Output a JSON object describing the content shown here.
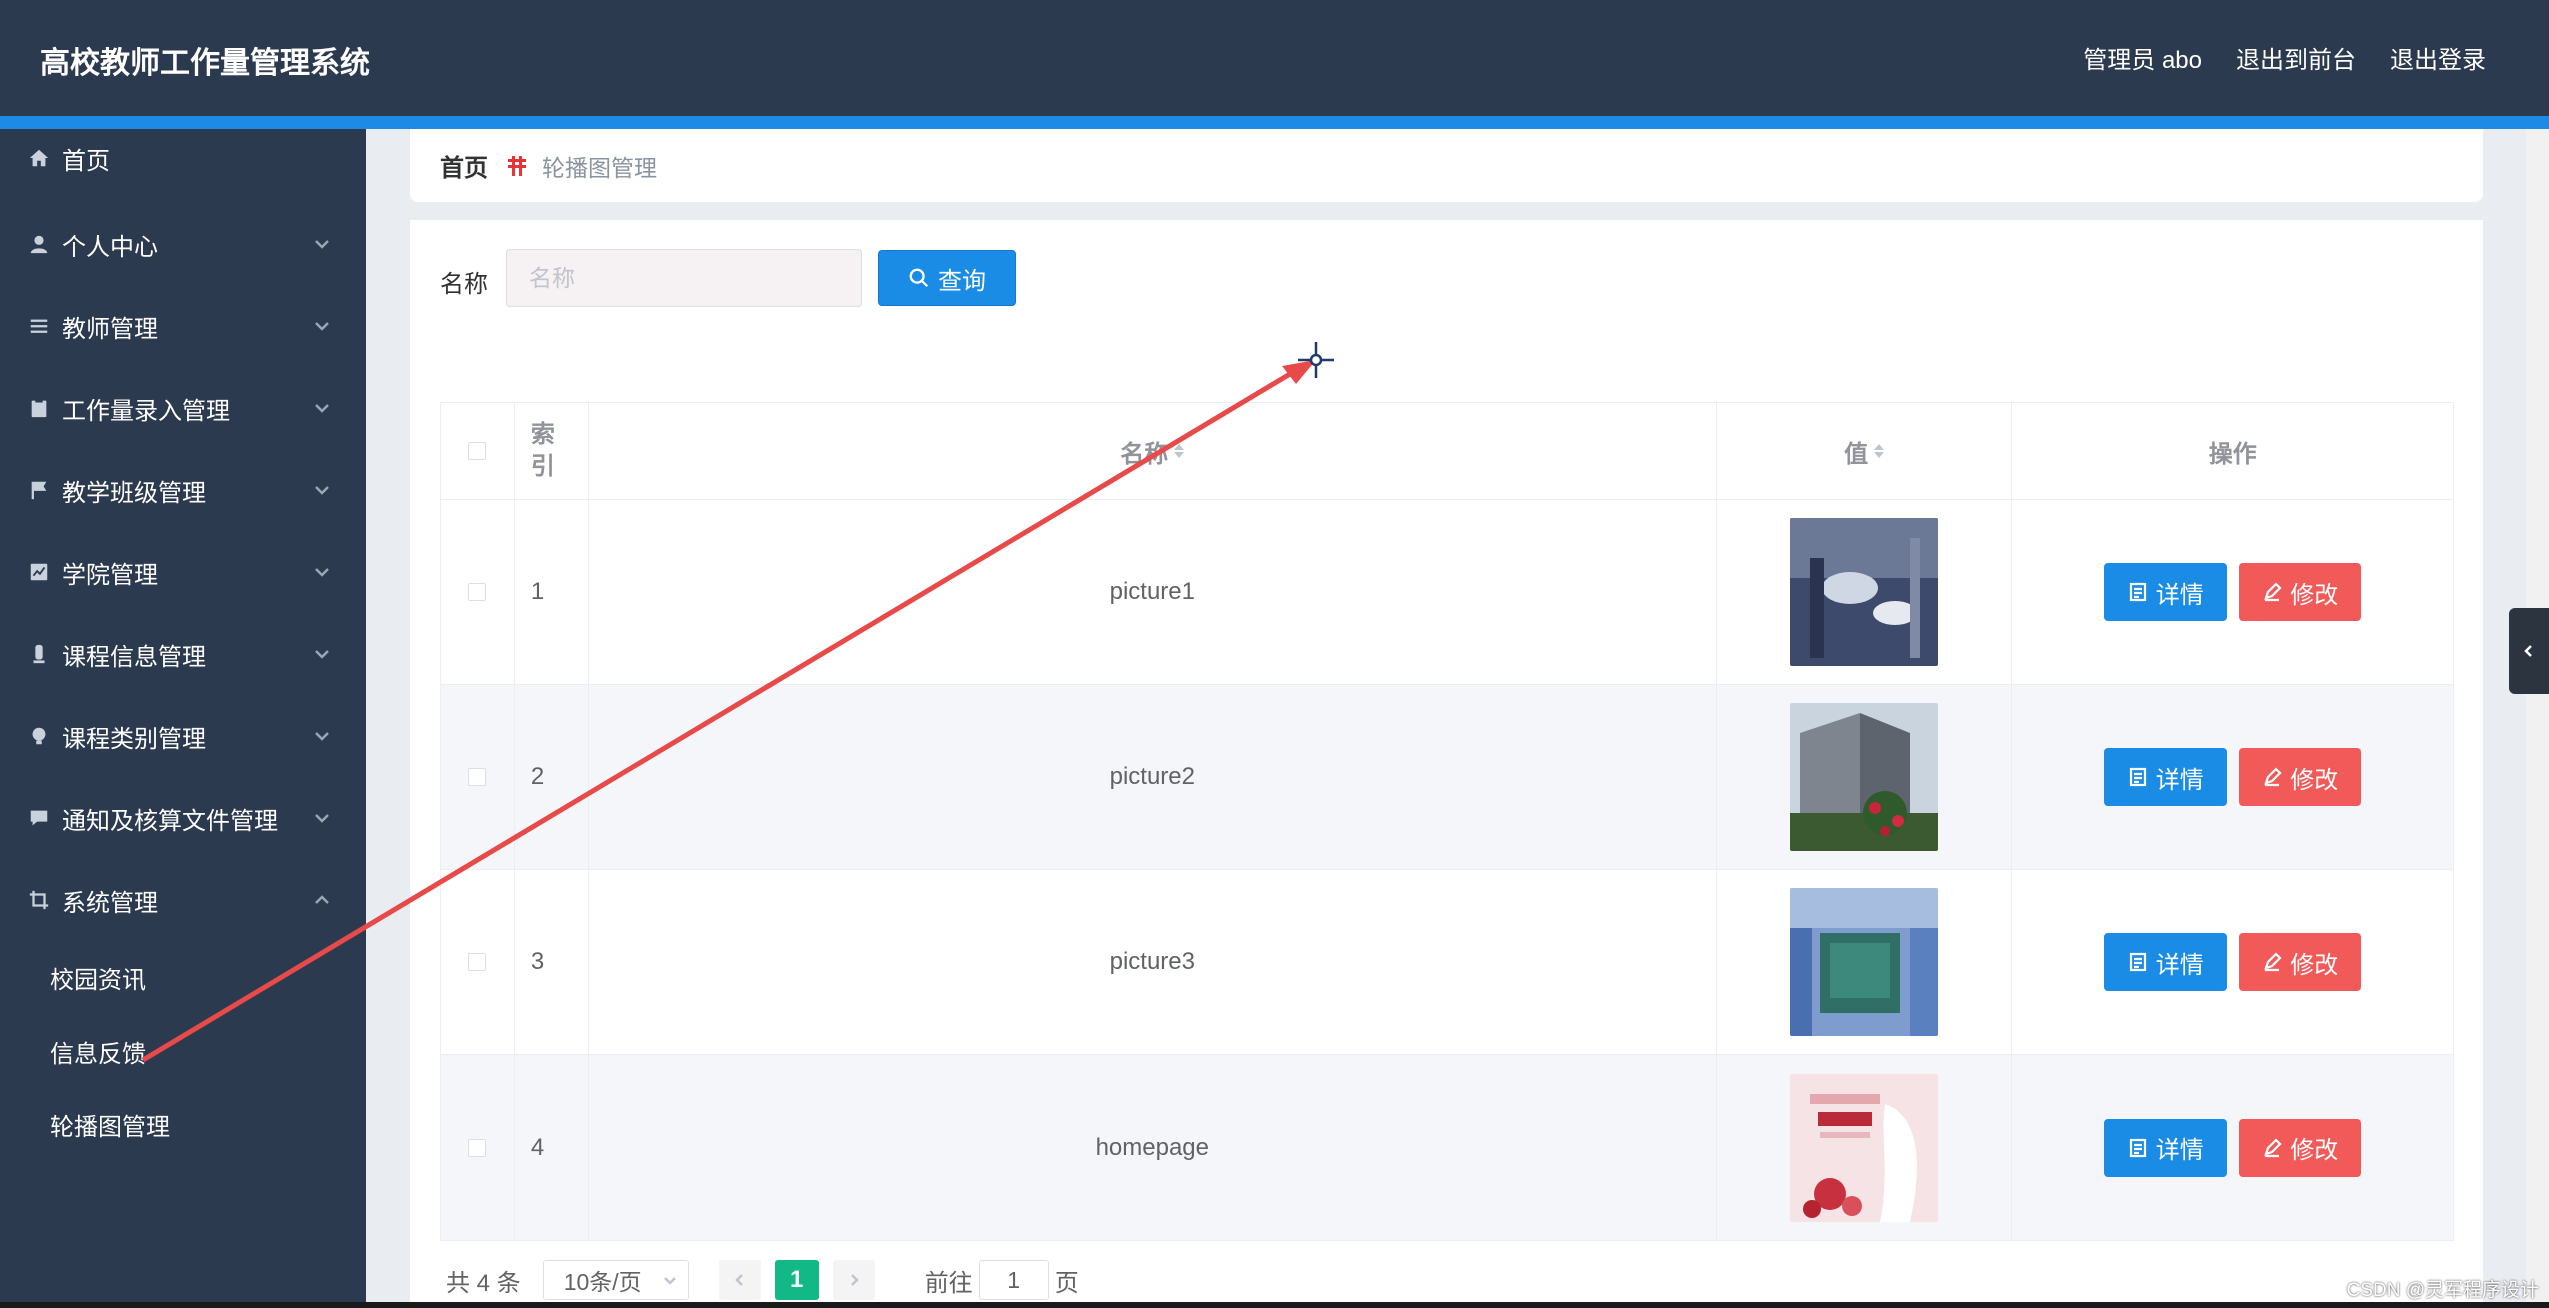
{
  "app": {
    "title": "高校教师工作量管理系统"
  },
  "header": {
    "admin_label": "管理员 abo",
    "to_front": "退出到前台",
    "logout": "退出登录"
  },
  "sidebar": {
    "items": [
      {
        "label": "首页",
        "icon": "home-icon",
        "expandable": false
      },
      {
        "label": "个人中心",
        "icon": "user-icon",
        "expandable": true
      },
      {
        "label": "教师管理",
        "icon": "list-icon",
        "expandable": true
      },
      {
        "label": "工作量录入管理",
        "icon": "clipboard-icon",
        "expandable": true
      },
      {
        "label": "教学班级管理",
        "icon": "flag-icon",
        "expandable": true
      },
      {
        "label": "学院管理",
        "icon": "chart-icon",
        "expandable": true
      },
      {
        "label": "课程信息管理",
        "icon": "tube-icon",
        "expandable": true
      },
      {
        "label": "课程类别管理",
        "icon": "bulb-icon",
        "expandable": true
      },
      {
        "label": "通知及核算文件管理",
        "icon": "chat-icon",
        "expandable": true
      },
      {
        "label": "系统管理",
        "icon": "crop-icon",
        "expandable": true,
        "expanded": true
      }
    ],
    "sub_items": [
      "校园资讯",
      "信息反馈",
      "轮播图管理"
    ]
  },
  "breadcrumb": {
    "home": "首页",
    "current": "轮播图管理"
  },
  "search": {
    "label": "名称",
    "placeholder": "名称",
    "value": "",
    "button": "查询"
  },
  "table": {
    "headers": {
      "index": "索引",
      "name": "名称",
      "value": "值",
      "actions": "操作"
    },
    "rows": [
      {
        "index": "1",
        "name": "picture1",
        "thumb_colors": [
          "#3d4a6b",
          "#8e9ab8"
        ]
      },
      {
        "index": "2",
        "name": "picture2",
        "thumb_colors": [
          "#6a6f78",
          "#b2263a"
        ]
      },
      {
        "index": "3",
        "name": "picture3",
        "thumb_colors": [
          "#4a6fb0",
          "#2f6f66"
        ]
      },
      {
        "index": "4",
        "name": "homepage",
        "thumb_colors": [
          "#f4d6da",
          "#c7303e"
        ]
      }
    ],
    "detail_label": "详情",
    "edit_label": "修改"
  },
  "pagination": {
    "total": "共 4 条",
    "page_size": "10条/页",
    "current_page": "1",
    "goto_prefix": "前往",
    "goto_value": "1",
    "goto_suffix": "页"
  },
  "watermark": "CSDN @灵军程序设计",
  "colors": {
    "header_bg": "#2c3a4f",
    "accent_blue": "#1b8ce6",
    "danger_red": "#f25a5a",
    "page_active": "#13b887",
    "annotation_arrow": "#e84a4a"
  }
}
